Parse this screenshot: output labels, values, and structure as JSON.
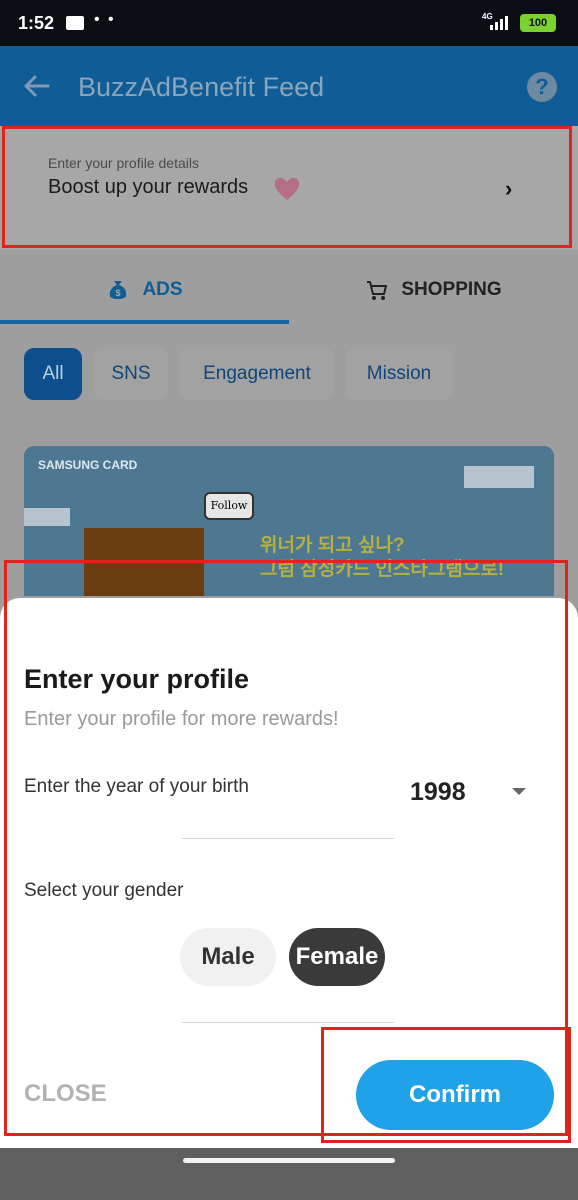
{
  "status_bar": {
    "time": "1:52",
    "network": "4G",
    "battery": "100",
    "icons": [
      "message-icon",
      "more-dots-icon",
      "signal-icon",
      "battery-icon"
    ]
  },
  "app_bar": {
    "title": "BuzzAdBenefit Feed",
    "help_glyph": "?",
    "icons": [
      "back-arrow-icon",
      "help-icon"
    ]
  },
  "profile_banner": {
    "subtitle": "Enter your profile details",
    "title": "Boost up your rewards",
    "chevron": "›",
    "icons": [
      "heart-icon",
      "chevron-right-icon"
    ]
  },
  "tabs": [
    {
      "label": "ADS",
      "active": true,
      "icon": "money-bag-icon"
    },
    {
      "label": "SHOPPING",
      "active": false,
      "icon": "shopping-cart-icon"
    }
  ],
  "filters": [
    {
      "label": "All",
      "active": true
    },
    {
      "label": "SNS",
      "active": false
    },
    {
      "label": "Engagement",
      "active": false
    },
    {
      "label": "Mission",
      "active": false
    }
  ],
  "ad_banner": {
    "brand": "SAMSUNG CARD",
    "bubble": "Follow",
    "headline": "위너가 되고 싶나?\n그럼 삼성카드 인스타그램으로!"
  },
  "sheet": {
    "title": "Enter your profile",
    "subtitle": "Enter your profile for more rewards!",
    "birth_label": "Enter the year of your birth",
    "birth_value": "1998",
    "gender_label": "Select your gender",
    "gender_options": [
      "Male",
      "Female"
    ],
    "selected_gender": "Female",
    "close_label": "CLOSE",
    "confirm_label": "Confirm"
  },
  "colors": {
    "accent": "#1fa2e8",
    "highlight": "#e0241b",
    "header": "#0f5c96"
  }
}
